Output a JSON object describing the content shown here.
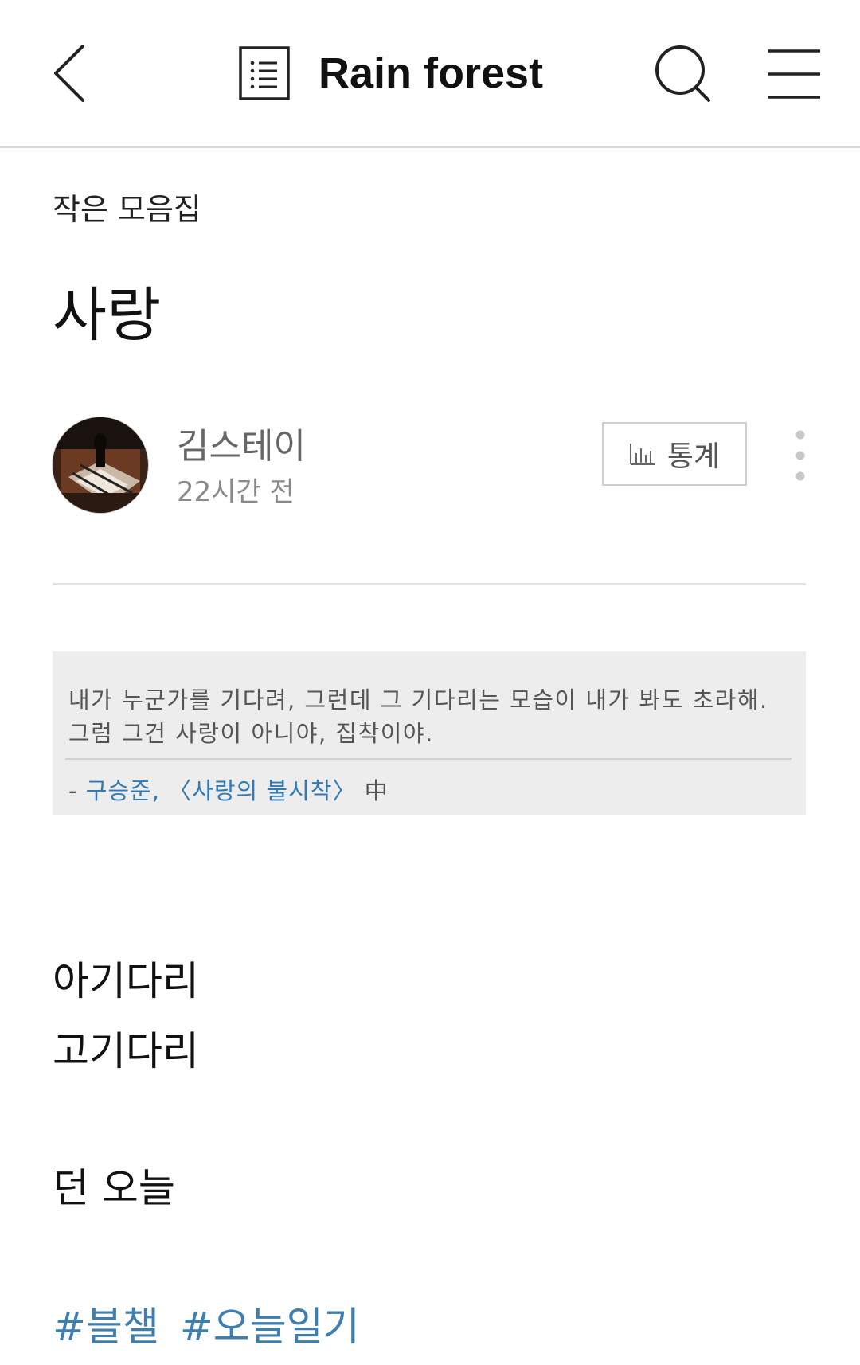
{
  "header": {
    "title": "Rain forest",
    "icons": {
      "back": "chevron-left-icon",
      "list": "post-list-icon",
      "search": "search-icon",
      "menu": "hamburger-menu-icon"
    }
  },
  "post": {
    "category": "작은 모음집",
    "title": "사랑",
    "author": "김스테이",
    "time": "22시간 전",
    "stats_label": "통계"
  },
  "quote": {
    "line1": "내가 누군가를 기다려, 그런데 그 기다리는 모습이 내가 봐도 초라해.",
    "line2": "그럼 그건 사랑이 아니야, 집착이야.",
    "dash": "- ",
    "author": "구승준",
    "sep": ", ",
    "book": "〈사랑의 불시착〉",
    "suffix": " 中"
  },
  "body": {
    "line1": "아기다리",
    "line2": "고기다리",
    "line3": "던 오늘"
  },
  "tags": [
    "#블챌",
    "#오늘일기"
  ],
  "colors": {
    "link": "#2f7ab8",
    "tag": "#3f7fb0",
    "quote_bg": "#ededed"
  }
}
